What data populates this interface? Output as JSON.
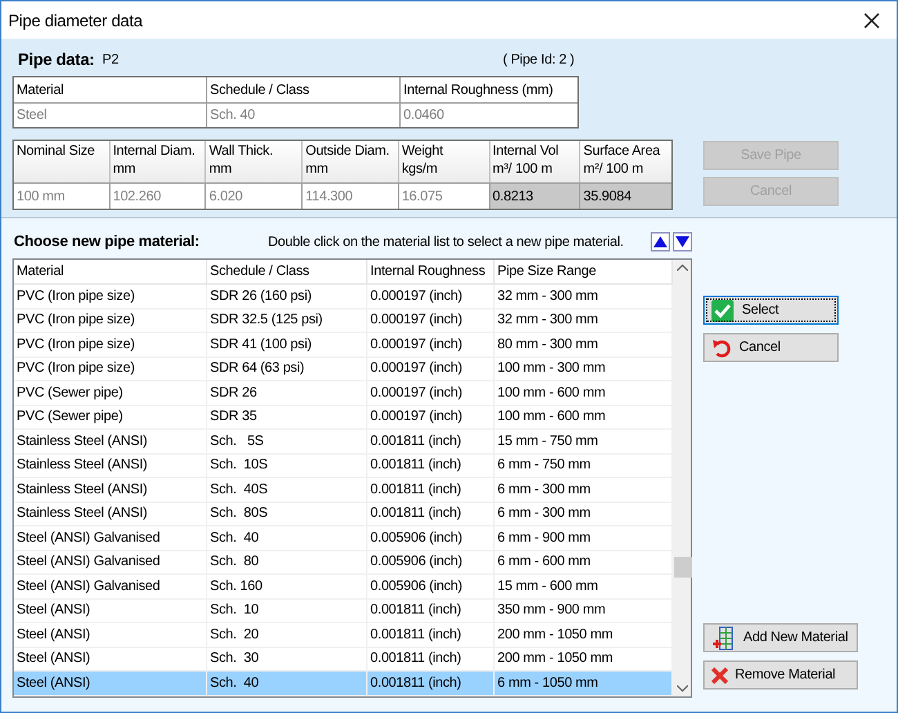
{
  "window": {
    "title": "Pipe diameter data"
  },
  "pipe_data": {
    "label": "Pipe data:",
    "name": "P2",
    "pipe_id": "( Pipe Id: 2 )"
  },
  "material_table": {
    "columns": [
      "Material",
      "Schedule / Class",
      "Internal Roughness (mm)"
    ],
    "values": [
      "Steel",
      "Sch. 40",
      "0.0460"
    ]
  },
  "dims_table": {
    "columns": [
      {
        "label": "Nominal Size"
      },
      {
        "label": "Internal Diam.",
        "unit": "mm"
      },
      {
        "label": "Wall Thick.",
        "unit": "mm"
      },
      {
        "label": "Outside Diam.",
        "unit": "mm"
      },
      {
        "label": "Weight",
        "unit": "kgs/m"
      },
      {
        "label": "Internal Vol",
        "unit": "m³/ 100 m"
      },
      {
        "label": "Surface Area",
        "unit": "m²/ 100 m"
      }
    ],
    "values": [
      {
        "text": "100 mm",
        "kind": "input"
      },
      {
        "text": "102.260",
        "kind": "input"
      },
      {
        "text": "6.020",
        "kind": "input"
      },
      {
        "text": "114.300",
        "kind": "input"
      },
      {
        "text": "16.075",
        "kind": "input"
      },
      {
        "text": "0.8213",
        "kind": "computed"
      },
      {
        "text": "35.9084",
        "kind": "computed"
      }
    ]
  },
  "pipe_buttons": [
    {
      "label": "Save Pipe",
      "disabled": true
    },
    {
      "label": "Cancel",
      "disabled": true
    }
  ],
  "choose": {
    "label": "Choose new pipe material:",
    "hint": "Double click on the material list to select a new pipe material."
  },
  "material_list": {
    "columns": [
      "Material",
      "Schedule / Class",
      "Internal Roughness",
      "Pipe Size Range"
    ],
    "rows": [
      {
        "cells": [
          "PVC (Iron pipe size)",
          "SDR 26 (160 psi)",
          "0.000197 (inch)",
          "32 mm - 300 mm"
        ],
        "selected": false
      },
      {
        "cells": [
          "PVC (Iron pipe size)",
          "SDR 32.5 (125 psi)",
          "0.000197 (inch)",
          "32 mm - 300 mm"
        ],
        "selected": false
      },
      {
        "cells": [
          "PVC (Iron pipe size)",
          "SDR 41 (100 psi)",
          "0.000197 (inch)",
          "80 mm - 300 mm"
        ],
        "selected": false
      },
      {
        "cells": [
          "PVC (Iron pipe size)",
          "SDR 64 (63 psi)",
          "0.000197 (inch)",
          "100 mm - 300 mm"
        ],
        "selected": false
      },
      {
        "cells": [
          "PVC (Sewer pipe)",
          "SDR 26",
          "0.000197 (inch)",
          "100 mm - 600 mm"
        ],
        "selected": false
      },
      {
        "cells": [
          "PVC (Sewer pipe)",
          "SDR 35",
          "0.000197 (inch)",
          "100 mm - 600 mm"
        ],
        "selected": false
      },
      {
        "cells": [
          "Stainless Steel (ANSI)",
          "Sch.   5S",
          "0.001811 (inch)",
          "15 mm - 750 mm"
        ],
        "selected": false
      },
      {
        "cells": [
          "Stainless Steel (ANSI)",
          "Sch.  10S",
          "0.001811 (inch)",
          "6 mm - 750 mm"
        ],
        "selected": false
      },
      {
        "cells": [
          "Stainless Steel (ANSI)",
          "Sch.  40S",
          "0.001811 (inch)",
          "6 mm - 300 mm"
        ],
        "selected": false
      },
      {
        "cells": [
          "Stainless Steel (ANSI)",
          "Sch.  80S",
          "0.001811 (inch)",
          "6 mm - 300 mm"
        ],
        "selected": false
      },
      {
        "cells": [
          "Steel (ANSI) Galvanised",
          "Sch.  40",
          "0.005906 (inch)",
          "6 mm - 900 mm"
        ],
        "selected": false
      },
      {
        "cells": [
          "Steel (ANSI) Galvanised",
          "Sch.  80",
          "0.005906 (inch)",
          "6 mm - 600 mm"
        ],
        "selected": false
      },
      {
        "cells": [
          "Steel (ANSI) Galvanised",
          "Sch. 160",
          "0.005906 (inch)",
          "15 mm - 600 mm"
        ],
        "selected": false
      },
      {
        "cells": [
          "Steel (ANSI)",
          "Sch.  10",
          "0.001811 (inch)",
          "350 mm - 900 mm"
        ],
        "selected": false
      },
      {
        "cells": [
          "Steel (ANSI)",
          "Sch.  20",
          "0.001811 (inch)",
          "200 mm - 1050 mm"
        ],
        "selected": false
      },
      {
        "cells": [
          "Steel (ANSI)",
          "Sch.  30",
          "0.001811 (inch)",
          "200 mm - 1050 mm"
        ],
        "selected": false
      },
      {
        "cells": [
          "Steel (ANSI)",
          "Sch.  40",
          "0.001811 (inch)",
          "6 mm - 1050 mm"
        ],
        "selected": true
      }
    ]
  },
  "list_buttons": [
    {
      "label": "Select",
      "kind": "check",
      "focused": true
    },
    {
      "label": "Cancel",
      "kind": "undo",
      "focused": false
    }
  ],
  "material_buttons": [
    {
      "label": "Add New Material",
      "kind": "add"
    },
    {
      "label": "Remove Material",
      "kind": "remove"
    }
  ]
}
